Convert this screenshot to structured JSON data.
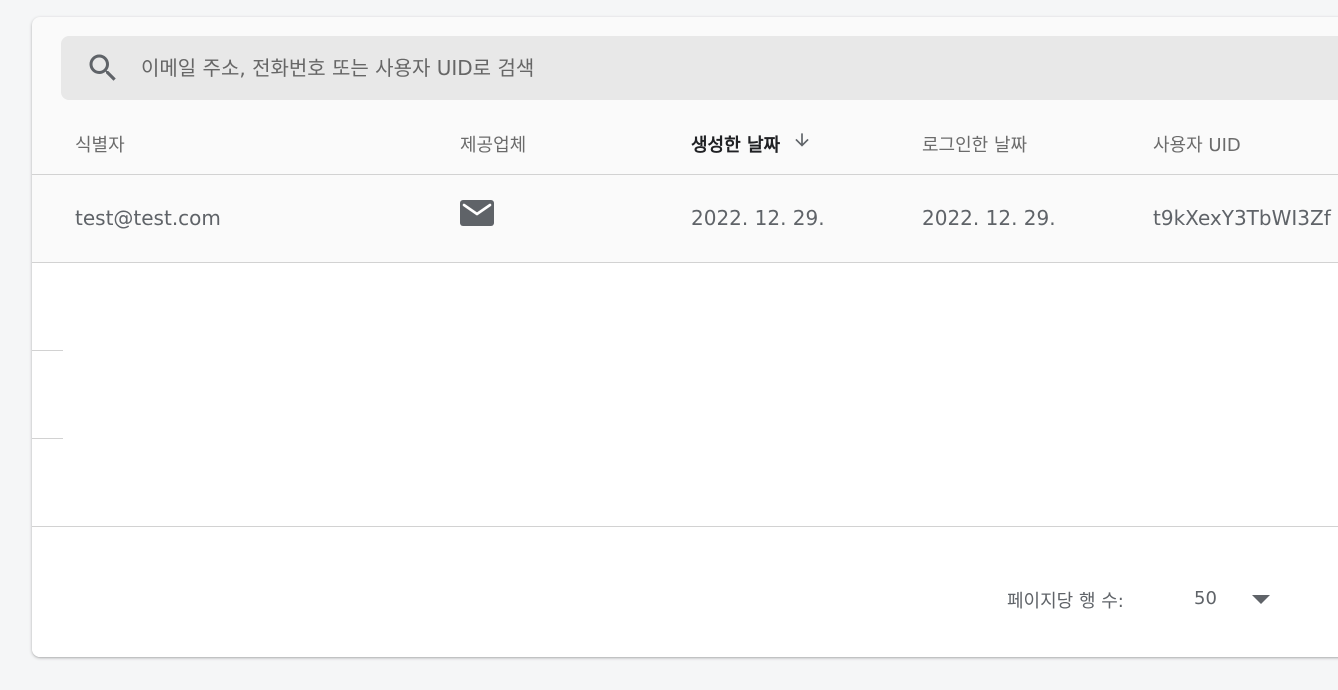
{
  "search": {
    "icon": "search-icon",
    "placeholder": "이메일 주소, 전화번호 또는 사용자 UID로 검색"
  },
  "table": {
    "columns": [
      {
        "label": "식별자",
        "sorted": false
      },
      {
        "label": "제공업체",
        "sorted": false
      },
      {
        "label": "생성한 날짜",
        "sorted": true,
        "sort_direction": "descending",
        "sort_icon": "arrow-down-icon"
      },
      {
        "label": "로그인한 날짜",
        "sorted": false
      },
      {
        "label": "사용자 UID",
        "sorted": false
      }
    ],
    "rows": [
      {
        "identifier": "test@test.com",
        "provider_icon": "email-icon",
        "created": "2022. 12. 29.",
        "signed_in": "2022. 12. 29.",
        "uid": "t9kXexY3TbWI3Zf"
      }
    ]
  },
  "pagination": {
    "rows_per_page_label": "페이지당 행 수:",
    "rows_per_page_value": "50",
    "dropdown_icon": "dropdown-arrow-icon"
  },
  "colors": {
    "card_background": "#fafafa",
    "search_background": "#e8e8e8",
    "text_primary": "#202124",
    "text_secondary": "#5f6368",
    "divider": "#d2d2d2"
  }
}
